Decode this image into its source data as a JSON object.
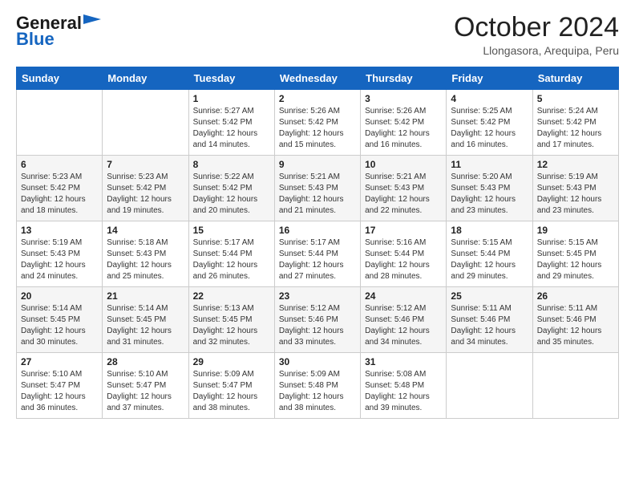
{
  "header": {
    "logo_general": "General",
    "logo_blue": "Blue",
    "month_title": "October 2024",
    "location": "Llongasora, Arequipa, Peru"
  },
  "weekdays": [
    "Sunday",
    "Monday",
    "Tuesday",
    "Wednesday",
    "Thursday",
    "Friday",
    "Saturday"
  ],
  "weeks": [
    [
      {
        "day": "",
        "info": ""
      },
      {
        "day": "",
        "info": ""
      },
      {
        "day": "1",
        "info": "Sunrise: 5:27 AM\nSunset: 5:42 PM\nDaylight: 12 hours\nand 14 minutes."
      },
      {
        "day": "2",
        "info": "Sunrise: 5:26 AM\nSunset: 5:42 PM\nDaylight: 12 hours\nand 15 minutes."
      },
      {
        "day": "3",
        "info": "Sunrise: 5:26 AM\nSunset: 5:42 PM\nDaylight: 12 hours\nand 16 minutes."
      },
      {
        "day": "4",
        "info": "Sunrise: 5:25 AM\nSunset: 5:42 PM\nDaylight: 12 hours\nand 16 minutes."
      },
      {
        "day": "5",
        "info": "Sunrise: 5:24 AM\nSunset: 5:42 PM\nDaylight: 12 hours\nand 17 minutes."
      }
    ],
    [
      {
        "day": "6",
        "info": "Sunrise: 5:23 AM\nSunset: 5:42 PM\nDaylight: 12 hours\nand 18 minutes."
      },
      {
        "day": "7",
        "info": "Sunrise: 5:23 AM\nSunset: 5:42 PM\nDaylight: 12 hours\nand 19 minutes."
      },
      {
        "day": "8",
        "info": "Sunrise: 5:22 AM\nSunset: 5:42 PM\nDaylight: 12 hours\nand 20 minutes."
      },
      {
        "day": "9",
        "info": "Sunrise: 5:21 AM\nSunset: 5:43 PM\nDaylight: 12 hours\nand 21 minutes."
      },
      {
        "day": "10",
        "info": "Sunrise: 5:21 AM\nSunset: 5:43 PM\nDaylight: 12 hours\nand 22 minutes."
      },
      {
        "day": "11",
        "info": "Sunrise: 5:20 AM\nSunset: 5:43 PM\nDaylight: 12 hours\nand 23 minutes."
      },
      {
        "day": "12",
        "info": "Sunrise: 5:19 AM\nSunset: 5:43 PM\nDaylight: 12 hours\nand 23 minutes."
      }
    ],
    [
      {
        "day": "13",
        "info": "Sunrise: 5:19 AM\nSunset: 5:43 PM\nDaylight: 12 hours\nand 24 minutes."
      },
      {
        "day": "14",
        "info": "Sunrise: 5:18 AM\nSunset: 5:43 PM\nDaylight: 12 hours\nand 25 minutes."
      },
      {
        "day": "15",
        "info": "Sunrise: 5:17 AM\nSunset: 5:44 PM\nDaylight: 12 hours\nand 26 minutes."
      },
      {
        "day": "16",
        "info": "Sunrise: 5:17 AM\nSunset: 5:44 PM\nDaylight: 12 hours\nand 27 minutes."
      },
      {
        "day": "17",
        "info": "Sunrise: 5:16 AM\nSunset: 5:44 PM\nDaylight: 12 hours\nand 28 minutes."
      },
      {
        "day": "18",
        "info": "Sunrise: 5:15 AM\nSunset: 5:44 PM\nDaylight: 12 hours\nand 29 minutes."
      },
      {
        "day": "19",
        "info": "Sunrise: 5:15 AM\nSunset: 5:45 PM\nDaylight: 12 hours\nand 29 minutes."
      }
    ],
    [
      {
        "day": "20",
        "info": "Sunrise: 5:14 AM\nSunset: 5:45 PM\nDaylight: 12 hours\nand 30 minutes."
      },
      {
        "day": "21",
        "info": "Sunrise: 5:14 AM\nSunset: 5:45 PM\nDaylight: 12 hours\nand 31 minutes."
      },
      {
        "day": "22",
        "info": "Sunrise: 5:13 AM\nSunset: 5:45 PM\nDaylight: 12 hours\nand 32 minutes."
      },
      {
        "day": "23",
        "info": "Sunrise: 5:12 AM\nSunset: 5:46 PM\nDaylight: 12 hours\nand 33 minutes."
      },
      {
        "day": "24",
        "info": "Sunrise: 5:12 AM\nSunset: 5:46 PM\nDaylight: 12 hours\nand 34 minutes."
      },
      {
        "day": "25",
        "info": "Sunrise: 5:11 AM\nSunset: 5:46 PM\nDaylight: 12 hours\nand 34 minutes."
      },
      {
        "day": "26",
        "info": "Sunrise: 5:11 AM\nSunset: 5:46 PM\nDaylight: 12 hours\nand 35 minutes."
      }
    ],
    [
      {
        "day": "27",
        "info": "Sunrise: 5:10 AM\nSunset: 5:47 PM\nDaylight: 12 hours\nand 36 minutes."
      },
      {
        "day": "28",
        "info": "Sunrise: 5:10 AM\nSunset: 5:47 PM\nDaylight: 12 hours\nand 37 minutes."
      },
      {
        "day": "29",
        "info": "Sunrise: 5:09 AM\nSunset: 5:47 PM\nDaylight: 12 hours\nand 38 minutes."
      },
      {
        "day": "30",
        "info": "Sunrise: 5:09 AM\nSunset: 5:48 PM\nDaylight: 12 hours\nand 38 minutes."
      },
      {
        "day": "31",
        "info": "Sunrise: 5:08 AM\nSunset: 5:48 PM\nDaylight: 12 hours\nand 39 minutes."
      },
      {
        "day": "",
        "info": ""
      },
      {
        "day": "",
        "info": ""
      }
    ]
  ]
}
